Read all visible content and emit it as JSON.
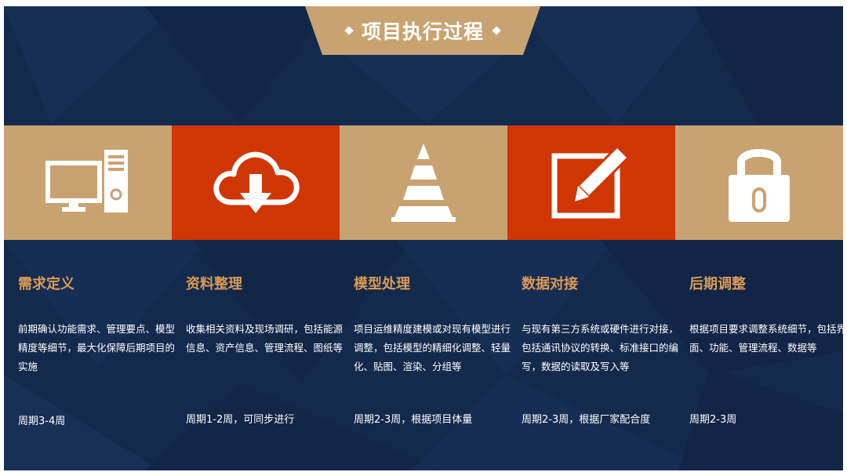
{
  "title": "项目执行过程",
  "colors": {
    "background": "#142a4c",
    "tan": "#c8a371",
    "red": "#cf3603",
    "heading": "#d99b55",
    "text": "#ffffff"
  },
  "steps": [
    {
      "icon": "computer-icon",
      "tile_color": "tan",
      "title": "需求定义",
      "description": "前期确认功能需求、管理要点、模型精度等细节，最大化保障后期项目的实施",
      "period": "周期3-4周"
    },
    {
      "icon": "cloud-download-icon",
      "tile_color": "red",
      "title": "资料整理",
      "description": "收集相关资料及现场调研，包括能源信息、资产信息、管理流程、图纸等",
      "period": "周期1-2周，可同步进行"
    },
    {
      "icon": "traffic-cone-icon",
      "tile_color": "tan",
      "title": "模型处理",
      "description": "项目运维精度建模或对现有模型进行调整，包括模型的精细化调整、轻量化、贴图、渲染、分组等",
      "period": "周期2-3周，根据项目体量"
    },
    {
      "icon": "edit-icon",
      "tile_color": "red",
      "title": "数据对接",
      "description": "与现有第三方系统或硬件进行对接，包括通讯协议的转换、标准接口的编写，数据的读取及写入等",
      "period": "周期2-3周，根据厂家配合度"
    },
    {
      "icon": "lock-icon",
      "tile_color": "tan",
      "title": "后期调整",
      "description": "根据项目要求调整系统细节，包括界面、功能、管理流程、数据等",
      "period": "周期2-3周"
    }
  ]
}
